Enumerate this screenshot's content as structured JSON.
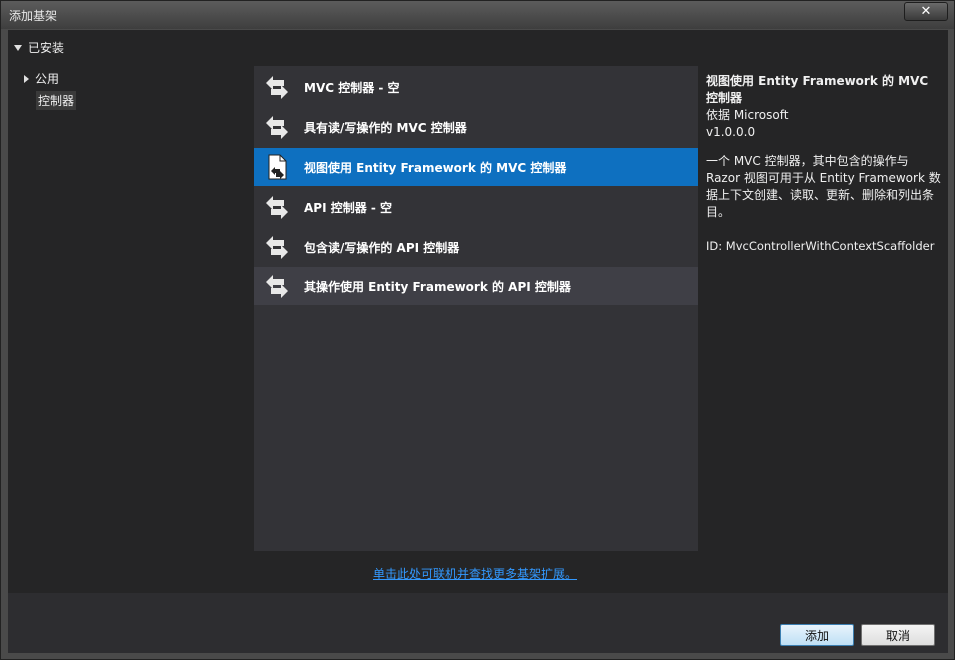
{
  "window": {
    "title": "添加基架",
    "close_glyph": "✕"
  },
  "tree": {
    "header": "已安装",
    "items": [
      {
        "label": "公用",
        "expandable": true
      },
      {
        "label": "控制器",
        "expandable": false,
        "selected": true
      }
    ]
  },
  "list": {
    "items": [
      {
        "label": "MVC 控制器 - 空",
        "icon": "controller-icon"
      },
      {
        "label": "具有读/写操作的 MVC 控制器",
        "icon": "controller-icon"
      },
      {
        "label": "视图使用 Entity Framework 的 MVC 控制器",
        "icon": "controller-with-views-icon",
        "selected": true
      },
      {
        "label": "API 控制器 - 空",
        "icon": "controller-icon"
      },
      {
        "label": "包含读/写操作的 API 控制器",
        "icon": "controller-icon"
      },
      {
        "label": "其操作使用 Entity Framework 的 API 控制器",
        "icon": "controller-icon",
        "hover": true
      }
    ]
  },
  "detail": {
    "title": "视图使用 Entity Framework 的 MVC 控制器",
    "author": "依据 Microsoft",
    "version": "v1.0.0.0",
    "description": "一个 MVC 控制器，其中包含的操作与 Razor 视图可用于从 Entity Framework 数据上下文创建、读取、更新、删除和列出条目。",
    "id": "ID: MvcControllerWithContextScaffolder"
  },
  "online_link": "单击此处可联机并查找更多基架扩展。",
  "buttons": {
    "add": "添加",
    "cancel": "取消"
  },
  "colors": {
    "selection": "#0e70c0",
    "link": "#3399ff",
    "panel": "#333337"
  }
}
